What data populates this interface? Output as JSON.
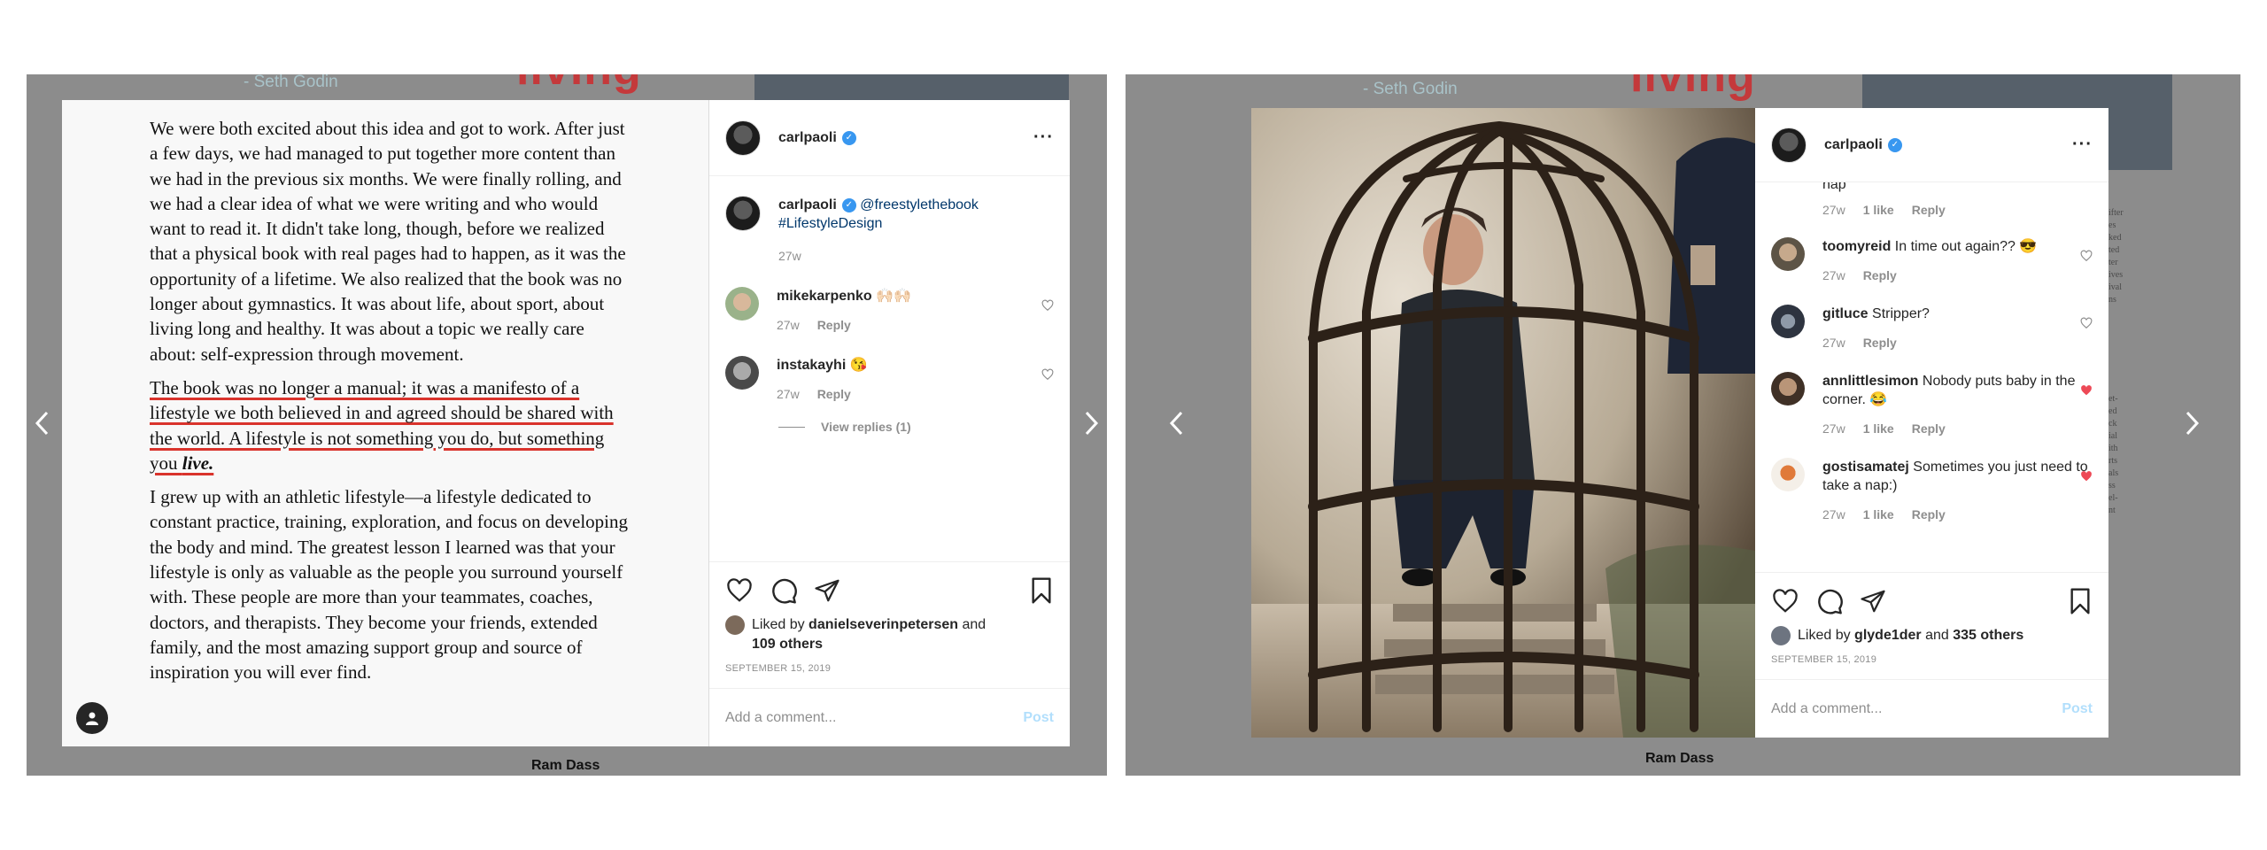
{
  "colors": {
    "accent_red": "#d9332c",
    "link_blue": "#00376b",
    "verified_blue": "#3897f0",
    "liked_red": "#ed4956"
  },
  "background": {
    "left": {
      "quote": "- Seth Godin",
      "title": "living",
      "author": "Ram Dass"
    },
    "right": {
      "quote": "- Seth Godin",
      "title": "living",
      "author": "Ram Dass"
    }
  },
  "left_post": {
    "username": "carlpaoli",
    "page_paragraphs": [
      "We were both excited about this idea and got to work. After just a few days, we had managed to put together more content than we had in the previous six months. We were finally rolling, and we had a clear idea of what we were writing and who would want to read it. It didn't take long, though, before we realized that a physical book with real pages had to happen, as it was the opportunity of a lifetime. We also realized that the book was no longer about gymnastics. It was about life, about sport, about living long and healthy. It was about a topic we really care about: self-expression through movement.",
      "The book was no longer a manual; it was a manifesto of a lifestyle we both believed in and agreed should be shared with the world. A lifestyle is not something you do, but something you ",
      "I grew up with an athletic lifestyle—a lifestyle dedicated to constant practice, training, exploration, and focus on developing the body and mind. The greatest lesson I learned was that your lifestyle is only as valuable as the people you surround yourself with. These people are more than your teammates, coaches, doctors, and therapists. They become your friends, extended family, and the most amazing support group and source of inspiration you will ever find."
    ],
    "emphasis_word": "live.",
    "caption": {
      "user": "carlpaoli",
      "mention": "@freestylethebook",
      "hashtag": "#LifestyleDesign",
      "time": "27w"
    },
    "comments": [
      {
        "user": "mikekarpenko",
        "text": "🙌🏻🙌🏻",
        "time": "27w",
        "reply": "Reply"
      },
      {
        "user": "instakayhi",
        "text": "😘",
        "time": "27w",
        "reply": "Reply"
      }
    ],
    "view_replies": "View replies (1)",
    "liked_by_prefix": "Liked by",
    "liked_by_user": "danielseverinpetersen",
    "liked_by_and": "and",
    "liked_by_others": "109 others",
    "date": "SEPTEMBER 15, 2019",
    "comment_placeholder": "Add a comment...",
    "post_label": "Post"
  },
  "right_post": {
    "username": "carlpaoli",
    "partial_comment": {
      "text": "nap",
      "time": "27w",
      "likes": "1 like",
      "reply": "Reply"
    },
    "comments": [
      {
        "user": "toomyreid",
        "text": "In time out again?? 😎",
        "time": "27w",
        "likes": "",
        "reply": "Reply",
        "liked": false
      },
      {
        "user": "gitluce",
        "text": "Stripper?",
        "time": "27w",
        "likes": "",
        "reply": "Reply",
        "liked": false
      },
      {
        "user": "annlittlesimon",
        "text": "Nobody puts baby in the corner. 😂",
        "time": "27w",
        "likes": "1 like",
        "reply": "Reply",
        "liked": true
      },
      {
        "user": "gostisamatej",
        "text": "Sometimes you just need to take a nap:)",
        "time": "27w",
        "likes": "1 like",
        "reply": "Reply",
        "liked": true
      }
    ],
    "liked_by_prefix": "Liked by",
    "liked_by_user": "glyde1der",
    "liked_by_and": "and",
    "liked_by_others": "335 others",
    "date": "SEPTEMBER 15, 2019",
    "comment_placeholder": "Add a comment...",
    "post_label": "Post"
  }
}
